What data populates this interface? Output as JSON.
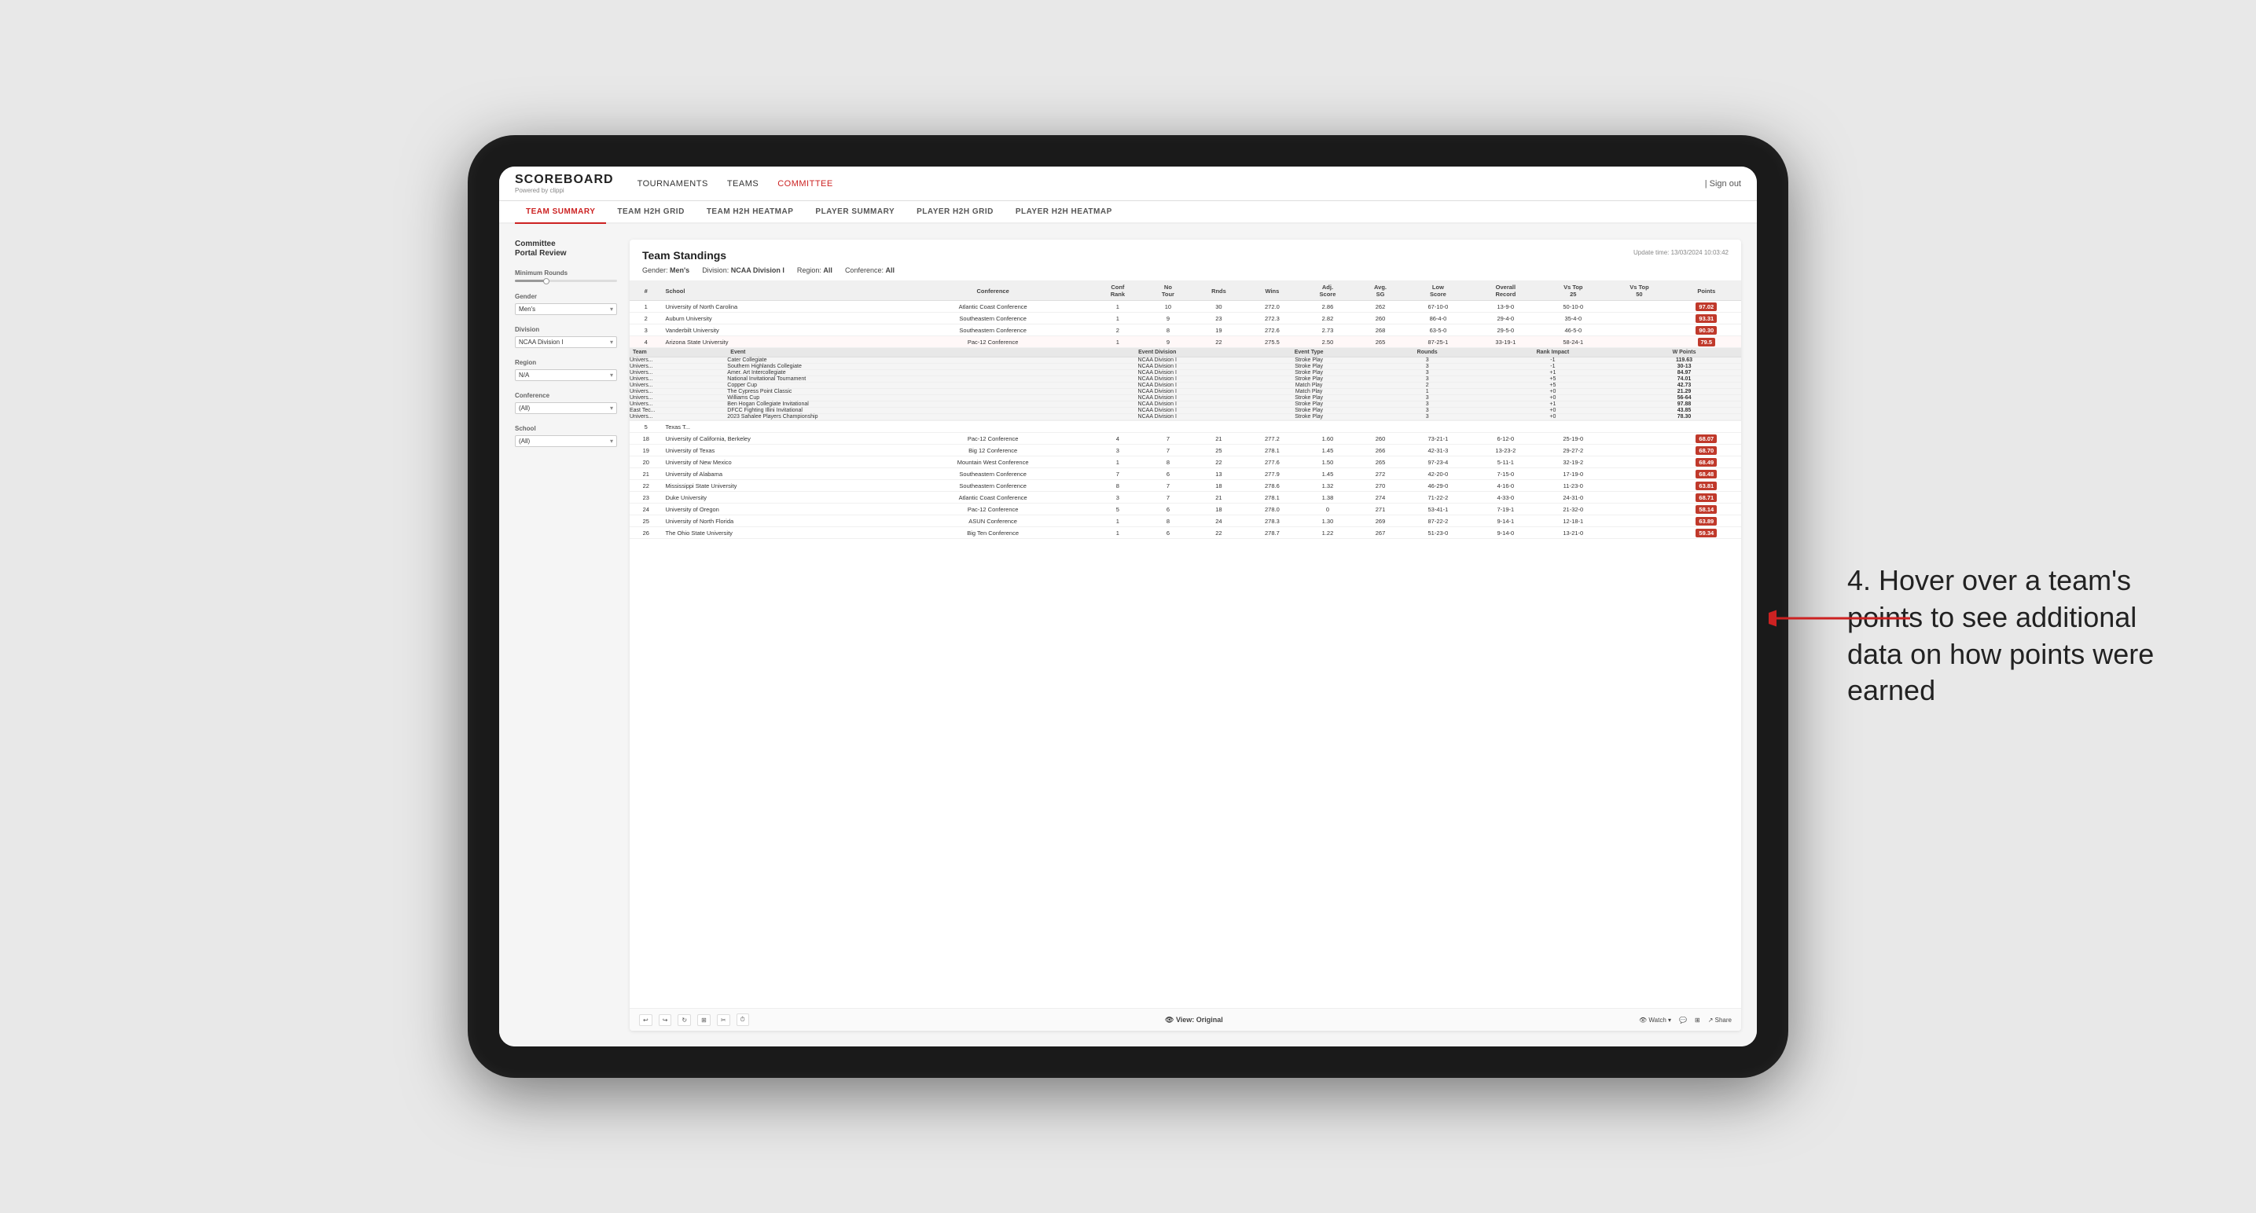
{
  "app": {
    "logo": "SCOREBOARD",
    "logo_sub": "Powered by clippi",
    "sign_out": "Sign out"
  },
  "nav": {
    "items": [
      {
        "label": "TOURNAMENTS",
        "active": false
      },
      {
        "label": "TEAMS",
        "active": false
      },
      {
        "label": "COMMITTEE",
        "active": true
      }
    ]
  },
  "sub_nav": {
    "items": [
      {
        "label": "TEAM SUMMARY",
        "active": true
      },
      {
        "label": "TEAM H2H GRID",
        "active": false
      },
      {
        "label": "TEAM H2H HEATMAP",
        "active": false
      },
      {
        "label": "PLAYER SUMMARY",
        "active": false
      },
      {
        "label": "PLAYER H2H GRID",
        "active": false
      },
      {
        "label": "PLAYER H2H HEATMAP",
        "active": false
      }
    ]
  },
  "left_panel": {
    "title": "Committee\nPortal Review",
    "filters": [
      {
        "label": "Minimum Rounds",
        "type": "slider"
      },
      {
        "label": "Gender",
        "value": "Men's",
        "type": "dropdown"
      },
      {
        "label": "Division",
        "value": "NCAA Division I",
        "type": "dropdown"
      },
      {
        "label": "Region",
        "value": "N/A",
        "type": "dropdown"
      },
      {
        "label": "Conference",
        "value": "(All)",
        "type": "dropdown"
      },
      {
        "label": "School",
        "value": "(All)",
        "type": "dropdown"
      }
    ]
  },
  "report": {
    "title": "Team Standings",
    "update_time": "Update time: 13/03/2024 10:03:42",
    "gender": "Men's",
    "division": "NCAA Division I",
    "region": "All",
    "conference": "All",
    "columns": [
      "#",
      "School",
      "Conference",
      "Conf Rank",
      "No Tour",
      "Rnds",
      "Wins",
      "Adj. Score",
      "Avg. SG",
      "Low Score",
      "Overall Record",
      "Vs Top 25",
      "Vs Top 50",
      "Points"
    ],
    "rows": [
      {
        "rank": 1,
        "school": "University of North Carolina",
        "conference": "Atlantic Coast Conference",
        "conf_rank": 1,
        "no_tour": 10,
        "rnds": 30,
        "wins": 272.0,
        "adj_score": 2.86,
        "low_score": 262,
        "overall_record": "67-10-0",
        "vs25": "13-9-0",
        "vs50": "50-10-0",
        "points": "97.02",
        "points_type": "red",
        "expanded": false
      },
      {
        "rank": 2,
        "school": "Auburn University",
        "conference": "Southeastern Conference",
        "conf_rank": 1,
        "no_tour": 9,
        "rnds": 23,
        "wins": 272.3,
        "adj_score": 2.82,
        "low_score": 260,
        "overall_record": "86-4-0",
        "vs25": "29-4-0",
        "vs50": "35-4-0",
        "points": "93.31",
        "points_type": "red",
        "expanded": false
      },
      {
        "rank": 3,
        "school": "Vanderbilt University",
        "conference": "Southeastern Conference",
        "conf_rank": 2,
        "no_tour": 8,
        "rnds": 19,
        "wins": 272.6,
        "adj_score": 2.73,
        "low_score": 268,
        "overall_record": "63-5-0",
        "vs25": "29-5-0",
        "vs50": "46-5-0",
        "points": "90.30",
        "points_type": "red",
        "expanded": false
      },
      {
        "rank": 4,
        "school": "Arizona State University",
        "conference": "Pac-12 Conference",
        "conf_rank": 1,
        "no_tour": 9,
        "rnds": 22,
        "wins": 275.5,
        "adj_score": 2.5,
        "low_score": 265,
        "overall_record": "87-25-1",
        "vs25": "33-19-1",
        "vs50": "58-24-1",
        "points": "79.5",
        "points_type": "red",
        "highlight": true,
        "expanded": true
      },
      {
        "rank": 5,
        "school": "Texas T...",
        "conference": "",
        "conf_rank": "",
        "no_tour": "",
        "rnds": "",
        "wins": "",
        "adj_score": "",
        "low_score": "",
        "overall_record": "",
        "vs25": "",
        "vs50": "",
        "points": "",
        "expanded": false
      }
    ],
    "expanded_data": {
      "team": "Arizona State University",
      "columns": [
        "Team",
        "Event",
        "Event Division",
        "Event Type",
        "Rounds",
        "Rank Impact",
        "W Points"
      ],
      "rows": [
        {
          "team": "Univers...",
          "event": "Cater Collegiate",
          "division": "NCAA Division I",
          "type": "Stroke Play",
          "rounds": 3,
          "rank_impact": -1,
          "points": "119.63"
        },
        {
          "team": "Univers...",
          "event": "Southern Highlands Collegiate",
          "division": "NCAA Division I",
          "type": "Stroke Play",
          "rounds": 3,
          "rank_impact": -1,
          "points": "30-13"
        },
        {
          "team": "Univers...",
          "event": "Amer. Art Intercollegiate",
          "division": "NCAA Division I",
          "type": "Stroke Play",
          "rounds": 3,
          "rank_impact": "+1",
          "points": "84.97"
        },
        {
          "team": "Univers...",
          "event": "National Invitational Tournament",
          "division": "NCAA Division I",
          "type": "Stroke Play",
          "rounds": 3,
          "rank_impact": "+5",
          "points": "74.01"
        },
        {
          "team": "Univers...",
          "event": "Copper Cup",
          "division": "NCAA Division I",
          "type": "Match Play",
          "rounds": 2,
          "rank_impact": "+5",
          "points": "42.73"
        },
        {
          "team": "Univers...",
          "event": "The Cypress Point Classic",
          "division": "NCAA Division I",
          "type": "Match Play",
          "rounds": 1,
          "rank_impact": "+0",
          "points": "21.29"
        },
        {
          "team": "Univers...",
          "event": "Williams Cup",
          "division": "NCAA Division I",
          "type": "Stroke Play",
          "rounds": 3,
          "rank_impact": "+0",
          "points": "56-64"
        },
        {
          "team": "Univers...",
          "event": "Ben Hogan Collegiate Invitational",
          "division": "NCAA Division I",
          "type": "Stroke Play",
          "rounds": 3,
          "rank_impact": "+1",
          "points": "97.88"
        },
        {
          "team": "East Tec...",
          "event": "DFCC Fighting Illini Invitational",
          "division": "NCAA Division I",
          "type": "Stroke Play",
          "rounds": 3,
          "rank_impact": "+0",
          "points": "43.85"
        },
        {
          "team": "Univers...",
          "event": "2023 Sahalee Players Championship",
          "division": "NCAA Division I",
          "type": "Stroke Play",
          "rounds": 3,
          "rank_impact": "+0",
          "points": "78.30"
        }
      ]
    },
    "lower_rows": [
      {
        "rank": 18,
        "school": "University of California, Berkeley",
        "conference": "Pac-12 Conference",
        "conf_rank": 4,
        "no_tour": 7,
        "rnds": 21,
        "wins": 277.2,
        "adj_score": 1.6,
        "low_score": 260,
        "overall_record": "73-21-1",
        "vs25": "6-12-0",
        "vs50": "25-19-0",
        "points": "68.07"
      },
      {
        "rank": 19,
        "school": "University of Texas",
        "conference": "Big 12 Conference",
        "conf_rank": 3,
        "no_tour": 7,
        "rnds": 25,
        "wins": 278.1,
        "adj_score": 1.45,
        "low_score": 266,
        "overall_record": "42-31-3",
        "vs25": "13-23-2",
        "vs50": "29-27-2",
        "points": "68.70"
      },
      {
        "rank": 20,
        "school": "University of New Mexico",
        "conference": "Mountain West Conference",
        "conf_rank": 1,
        "no_tour": 8,
        "rnds": 22,
        "wins": 277.6,
        "adj_score": 1.5,
        "low_score": 265,
        "overall_record": "97-23-4",
        "vs25": "5-11-1",
        "vs50": "32-19-2",
        "points": "68.49"
      },
      {
        "rank": 21,
        "school": "University of Alabama",
        "conference": "Southeastern Conference",
        "conf_rank": 7,
        "no_tour": 6,
        "rnds": 13,
        "wins": 277.9,
        "adj_score": 1.45,
        "low_score": 272,
        "overall_record": "42-20-0",
        "vs25": "7-15-0",
        "vs50": "17-19-0",
        "points": "68.48"
      },
      {
        "rank": 22,
        "school": "Mississippi State University",
        "conference": "Southeastern Conference",
        "conf_rank": 8,
        "no_tour": 7,
        "rnds": 18,
        "wins": 278.6,
        "adj_score": 1.32,
        "low_score": 270,
        "overall_record": "46-29-0",
        "vs25": "4-16-0",
        "vs50": "11-23-0",
        "points": "63.81"
      },
      {
        "rank": 23,
        "school": "Duke University",
        "conference": "Atlantic Coast Conference",
        "conf_rank": 3,
        "no_tour": 7,
        "rnds": 21,
        "wins": 278.1,
        "adj_score": 1.38,
        "low_score": 274,
        "overall_record": "71-22-2",
        "vs25": "4-33-0",
        "vs50": "24-31-0",
        "points": "68.71"
      },
      {
        "rank": 24,
        "school": "University of Oregon",
        "conference": "Pac-12 Conference",
        "conf_rank": 5,
        "no_tour": 6,
        "rnds": 18,
        "wins": 278.0,
        "adj_score": 0,
        "low_score": 271,
        "overall_record": "53-41-1",
        "vs25": "7-19-1",
        "vs50": "21-32-0",
        "points": "58.14"
      },
      {
        "rank": 25,
        "school": "University of North Florida",
        "conference": "ASUN Conference",
        "conf_rank": 1,
        "no_tour": 8,
        "rnds": 24,
        "wins": 278.3,
        "adj_score": 1.3,
        "low_score": 269,
        "overall_record": "87-22-2",
        "vs25": "9-14-1",
        "vs50": "12-18-1",
        "points": "63.89"
      },
      {
        "rank": 26,
        "school": "The Ohio State University",
        "conference": "Big Ten Conference",
        "conf_rank": 1,
        "no_tour": 6,
        "rnds": 22,
        "wins": 278.7,
        "adj_score": 1.22,
        "low_score": 267,
        "overall_record": "51-23-0",
        "vs25": "9-14-0",
        "vs50": "13-21-0",
        "points": "59.34"
      }
    ],
    "footer": {
      "view_label": "View: Original",
      "watch_label": "Watch",
      "share_label": "Share"
    }
  },
  "annotation": {
    "text": "4. Hover over a team's points to see additional data on how points were earned"
  }
}
